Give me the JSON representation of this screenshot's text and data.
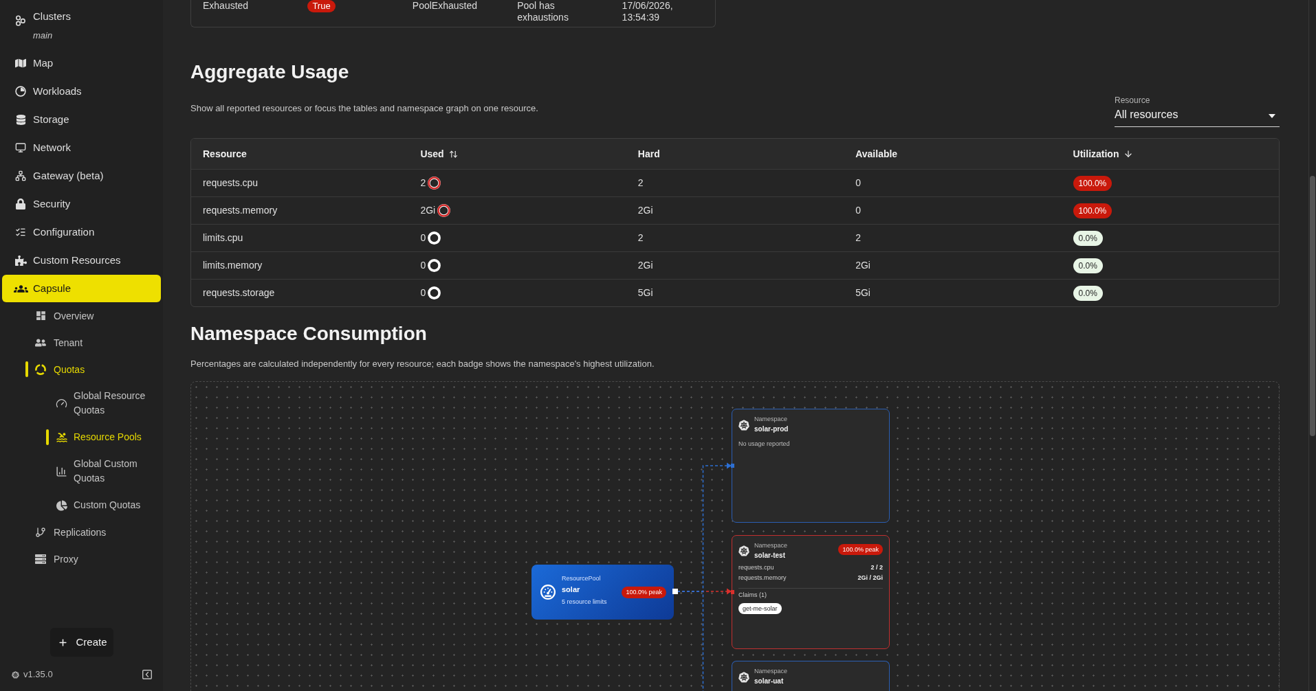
{
  "sidebar": {
    "items": [
      {
        "label": "Clusters",
        "sublabel": "main",
        "selected": false
      },
      {
        "label": "Map",
        "selected": false
      },
      {
        "label": "Workloads",
        "selected": false
      },
      {
        "label": "Storage",
        "selected": false
      },
      {
        "label": "Network",
        "selected": false
      },
      {
        "label": "Gateway (beta)",
        "selected": false
      },
      {
        "label": "Security",
        "selected": false
      },
      {
        "label": "Configuration",
        "selected": false
      },
      {
        "label": "Custom Resources",
        "selected": false
      },
      {
        "label": "Capsule",
        "selected": true,
        "children": [
          {
            "label": "Overview",
            "selected": false
          },
          {
            "label": "Tenant",
            "selected": false
          },
          {
            "label": "Quotas",
            "selected": true,
            "children": [
              {
                "label": "Global Resource Quotas",
                "selected": false
              },
              {
                "label": "Resource Pools",
                "selected": true
              },
              {
                "label": "Global Custom Quotas",
                "selected": false
              },
              {
                "label": "Custom Quotas",
                "selected": false
              }
            ]
          },
          {
            "label": "Replications",
            "selected": false
          },
          {
            "label": "Proxy",
            "selected": false
          }
        ]
      }
    ],
    "create_button": "Create",
    "version": "v1.35.0"
  },
  "conditions_table": {
    "rows": [
      {
        "column_1": "Exhausted",
        "column_2": "True",
        "column_3": "PoolExhausted",
        "column_4": "Pool has exhaustions",
        "column_5": "17/06/2026, 13:54:39"
      }
    ]
  },
  "aggregate_usage": {
    "title": "Aggregate Usage",
    "description": "Show all reported resources or focus the tables and namespace graph on one resource.",
    "resource_select": {
      "label": "Resource",
      "value": "All resources"
    },
    "table": {
      "columns": [
        {
          "label": "Resource",
          "sortable": false,
          "sorted": false
        },
        {
          "label": "Used",
          "sortable": true,
          "sorted": false
        },
        {
          "label": "Hard",
          "sortable": false,
          "sorted": false
        },
        {
          "label": "Available",
          "sortable": false,
          "sorted": false
        },
        {
          "label": "Utilization",
          "sortable": true,
          "sorted": true
        }
      ],
      "rows": [
        {
          "resource": "requests.cpu",
          "used": "2",
          "hard": "2",
          "available": "0",
          "utilization": "100.0%",
          "exhausted": true
        },
        {
          "resource": "requests.memory",
          "used": "2Gi",
          "hard": "2Gi",
          "available": "0",
          "utilization": "100.0%",
          "exhausted": true
        },
        {
          "resource": "limits.cpu",
          "used": "0",
          "hard": "2",
          "available": "2",
          "utilization": "0.0%",
          "exhausted": false
        },
        {
          "resource": "limits.memory",
          "used": "0",
          "hard": "2Gi",
          "available": "2Gi",
          "utilization": "0.0%",
          "exhausted": false
        },
        {
          "resource": "requests.storage",
          "used": "0",
          "hard": "5Gi",
          "available": "5Gi",
          "utilization": "0.0%",
          "exhausted": false
        }
      ]
    }
  },
  "namespace_consumption": {
    "title": "Namespace Consumption",
    "description": "Percentages are calculated independently for every resource; each badge shows the namespace's highest utilization.",
    "graph": {
      "pool": {
        "type_label": "ResourcePool",
        "name": "solar",
        "badge": "100.0% peak",
        "subtitle": "5 resource limits"
      },
      "namespaces": [
        {
          "type_label": "Namespace",
          "name": "solar-prod",
          "exhausted": false,
          "note": "No usage reported"
        },
        {
          "type_label": "Namespace",
          "name": "solar-test",
          "exhausted": true,
          "badge": "100.0% peak",
          "usage": [
            {
              "resource": "requests.cpu",
              "value": "2 / 2"
            },
            {
              "resource": "requests.memory",
              "value": "2Gi / 2Gi"
            }
          ],
          "claims_label": "Claims (1)",
          "claims": [
            "get-me-solar"
          ]
        },
        {
          "type_label": "Namespace",
          "name": "solar-uat",
          "exhausted": false
        }
      ]
    }
  }
}
